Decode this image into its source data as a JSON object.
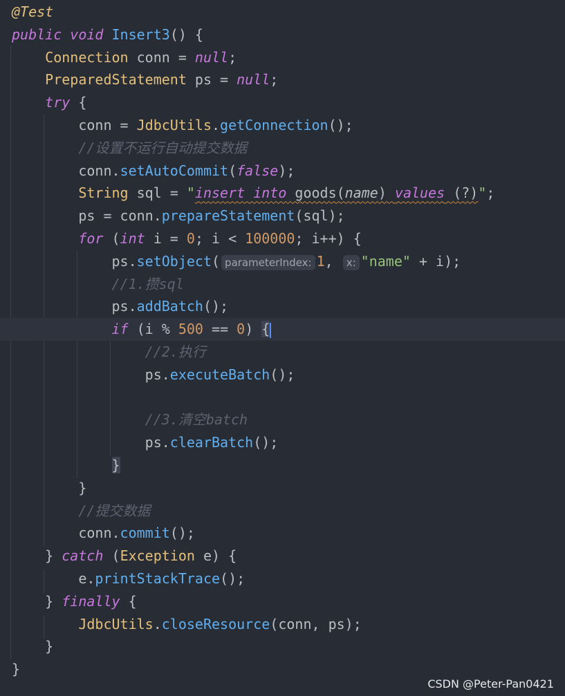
{
  "colors": {
    "background": "#282c34",
    "keyword": "#c678dd",
    "function": "#61afef",
    "class": "#e5c07b",
    "number": "#d19a66",
    "string": "#98c379",
    "comment": "#5c6370"
  },
  "code": {
    "lines": [
      {
        "tokens": [
          {
            "t": "ann",
            "text": "@Test"
          }
        ]
      },
      {
        "tokens": [
          {
            "t": "kw",
            "text": "public"
          },
          {
            "t": "",
            "text": " "
          },
          {
            "t": "kw",
            "text": "void"
          },
          {
            "t": "",
            "text": " "
          },
          {
            "t": "fn",
            "text": "Insert3"
          },
          {
            "t": "",
            "text": "() {"
          }
        ]
      },
      {
        "tokens": [
          {
            "t": "",
            "text": "    "
          },
          {
            "t": "cls",
            "text": "Connection"
          },
          {
            "t": "",
            "text": " conn = "
          },
          {
            "t": "kw",
            "text": "null"
          },
          {
            "t": "",
            "text": ";"
          }
        ]
      },
      {
        "tokens": [
          {
            "t": "",
            "text": "    "
          },
          {
            "t": "cls",
            "text": "PreparedStatement"
          },
          {
            "t": "",
            "text": " ps = "
          },
          {
            "t": "kw",
            "text": "null"
          },
          {
            "t": "",
            "text": ";"
          }
        ]
      },
      {
        "tokens": [
          {
            "t": "",
            "text": "    "
          },
          {
            "t": "kw",
            "text": "try"
          },
          {
            "t": "",
            "text": " {"
          }
        ]
      },
      {
        "tokens": [
          {
            "t": "",
            "text": "        conn = "
          },
          {
            "t": "cls",
            "text": "JdbcUtils"
          },
          {
            "t": "",
            "text": "."
          },
          {
            "t": "fn",
            "text": "getConnection"
          },
          {
            "t": "",
            "text": "();"
          }
        ]
      },
      {
        "tokens": [
          {
            "t": "",
            "text": "        "
          },
          {
            "t": "cm",
            "text": "//设置不运行自动提交数据"
          }
        ]
      },
      {
        "tokens": [
          {
            "t": "",
            "text": "        conn."
          },
          {
            "t": "fn",
            "text": "setAutoCommit"
          },
          {
            "t": "",
            "text": "("
          },
          {
            "t": "kw",
            "text": "false"
          },
          {
            "t": "",
            "text": ");"
          }
        ]
      },
      {
        "tokens": [
          {
            "t": "",
            "text": "        "
          },
          {
            "t": "cls",
            "text": "String"
          },
          {
            "t": "",
            "text": " sql = "
          },
          {
            "t": "str",
            "text": "\""
          },
          {
            "t": "sqlkw",
            "text": "insert into"
          },
          {
            "t": "sql",
            "text": " goods("
          },
          {
            "t": "sqlit",
            "text": "name"
          },
          {
            "t": "sql",
            "text": ") "
          },
          {
            "t": "sqlkw",
            "text": "values"
          },
          {
            "t": "sql",
            "text": " (?)"
          },
          {
            "t": "str",
            "text": "\""
          },
          {
            "t": "",
            "text": ";"
          }
        ]
      },
      {
        "tokens": [
          {
            "t": "",
            "text": "        ps = conn."
          },
          {
            "t": "fn",
            "text": "prepareStatement"
          },
          {
            "t": "",
            "text": "(sql);"
          }
        ]
      },
      {
        "tokens": [
          {
            "t": "",
            "text": "        "
          },
          {
            "t": "kw",
            "text": "for"
          },
          {
            "t": "",
            "text": " ("
          },
          {
            "t": "kw",
            "text": "int"
          },
          {
            "t": "",
            "text": " i = "
          },
          {
            "t": "num",
            "text": "0"
          },
          {
            "t": "",
            "text": "; i < "
          },
          {
            "t": "num",
            "text": "100000"
          },
          {
            "t": "",
            "text": "; i++) {"
          }
        ]
      },
      {
        "tokens": [
          {
            "t": "",
            "text": "            ps."
          },
          {
            "t": "fn",
            "text": "setObject"
          },
          {
            "t": "",
            "text": "("
          },
          {
            "t": "hint",
            "text": "parameterIndex:"
          },
          {
            "t": "num",
            "text": "1"
          },
          {
            "t": "",
            "text": ", "
          },
          {
            "t": "hint",
            "text": "x:"
          },
          {
            "t": "str",
            "text": "\"name\""
          },
          {
            "t": "",
            "text": " + i);"
          }
        ]
      },
      {
        "tokens": [
          {
            "t": "",
            "text": "            "
          },
          {
            "t": "cm",
            "text": "//1.攒sql"
          }
        ]
      },
      {
        "tokens": [
          {
            "t": "",
            "text": "            ps."
          },
          {
            "t": "fn",
            "text": "addBatch"
          },
          {
            "t": "",
            "text": "();"
          }
        ]
      },
      {
        "current": true,
        "tokens": [
          {
            "t": "",
            "text": "            "
          },
          {
            "t": "kw",
            "text": "if"
          },
          {
            "t": "",
            "text": " (i % "
          },
          {
            "t": "num",
            "text": "500"
          },
          {
            "t": "",
            "text": " == "
          },
          {
            "t": "num",
            "text": "0"
          },
          {
            "t": "",
            "text": ") "
          },
          {
            "t": "brace",
            "text": "{"
          },
          {
            "t": "caret",
            "text": ""
          }
        ]
      },
      {
        "tokens": [
          {
            "t": "",
            "text": "                "
          },
          {
            "t": "cm",
            "text": "//2.执行"
          }
        ]
      },
      {
        "tokens": [
          {
            "t": "",
            "text": "                ps."
          },
          {
            "t": "fn",
            "text": "executeBatch"
          },
          {
            "t": "",
            "text": "();"
          }
        ]
      },
      {
        "tokens": []
      },
      {
        "tokens": [
          {
            "t": "",
            "text": "                "
          },
          {
            "t": "cm",
            "text": "//3.清空batch"
          }
        ]
      },
      {
        "tokens": [
          {
            "t": "",
            "text": "                ps."
          },
          {
            "t": "fn",
            "text": "clearBatch"
          },
          {
            "t": "",
            "text": "();"
          }
        ]
      },
      {
        "tokens": [
          {
            "t": "",
            "text": "            "
          },
          {
            "t": "brace",
            "text": "}"
          }
        ]
      },
      {
        "tokens": [
          {
            "t": "",
            "text": "        }"
          }
        ]
      },
      {
        "tokens": [
          {
            "t": "",
            "text": "        "
          },
          {
            "t": "cm",
            "text": "//提交数据"
          }
        ]
      },
      {
        "tokens": [
          {
            "t": "",
            "text": "        conn."
          },
          {
            "t": "fn",
            "text": "commit"
          },
          {
            "t": "",
            "text": "();"
          }
        ]
      },
      {
        "tokens": [
          {
            "t": "",
            "text": "    } "
          },
          {
            "t": "kw",
            "text": "catch"
          },
          {
            "t": "",
            "text": " ("
          },
          {
            "t": "cls",
            "text": "Exception"
          },
          {
            "t": "",
            "text": " e) {"
          }
        ]
      },
      {
        "tokens": [
          {
            "t": "",
            "text": "        e."
          },
          {
            "t": "fn",
            "text": "printStackTrace"
          },
          {
            "t": "",
            "text": "();"
          }
        ]
      },
      {
        "tokens": [
          {
            "t": "",
            "text": "    } "
          },
          {
            "t": "kw",
            "text": "finally"
          },
          {
            "t": "",
            "text": " {"
          }
        ]
      },
      {
        "tokens": [
          {
            "t": "",
            "text": "        "
          },
          {
            "t": "cls",
            "text": "JdbcUtils"
          },
          {
            "t": "",
            "text": "."
          },
          {
            "t": "fn",
            "text": "closeResource"
          },
          {
            "t": "",
            "text": "(conn, ps);"
          }
        ]
      },
      {
        "tokens": [
          {
            "t": "",
            "text": "    }"
          }
        ]
      },
      {
        "tokens": [
          {
            "t": "",
            "text": "}"
          }
        ]
      }
    ]
  },
  "watermark": "CSDN @Peter-Pan0421"
}
